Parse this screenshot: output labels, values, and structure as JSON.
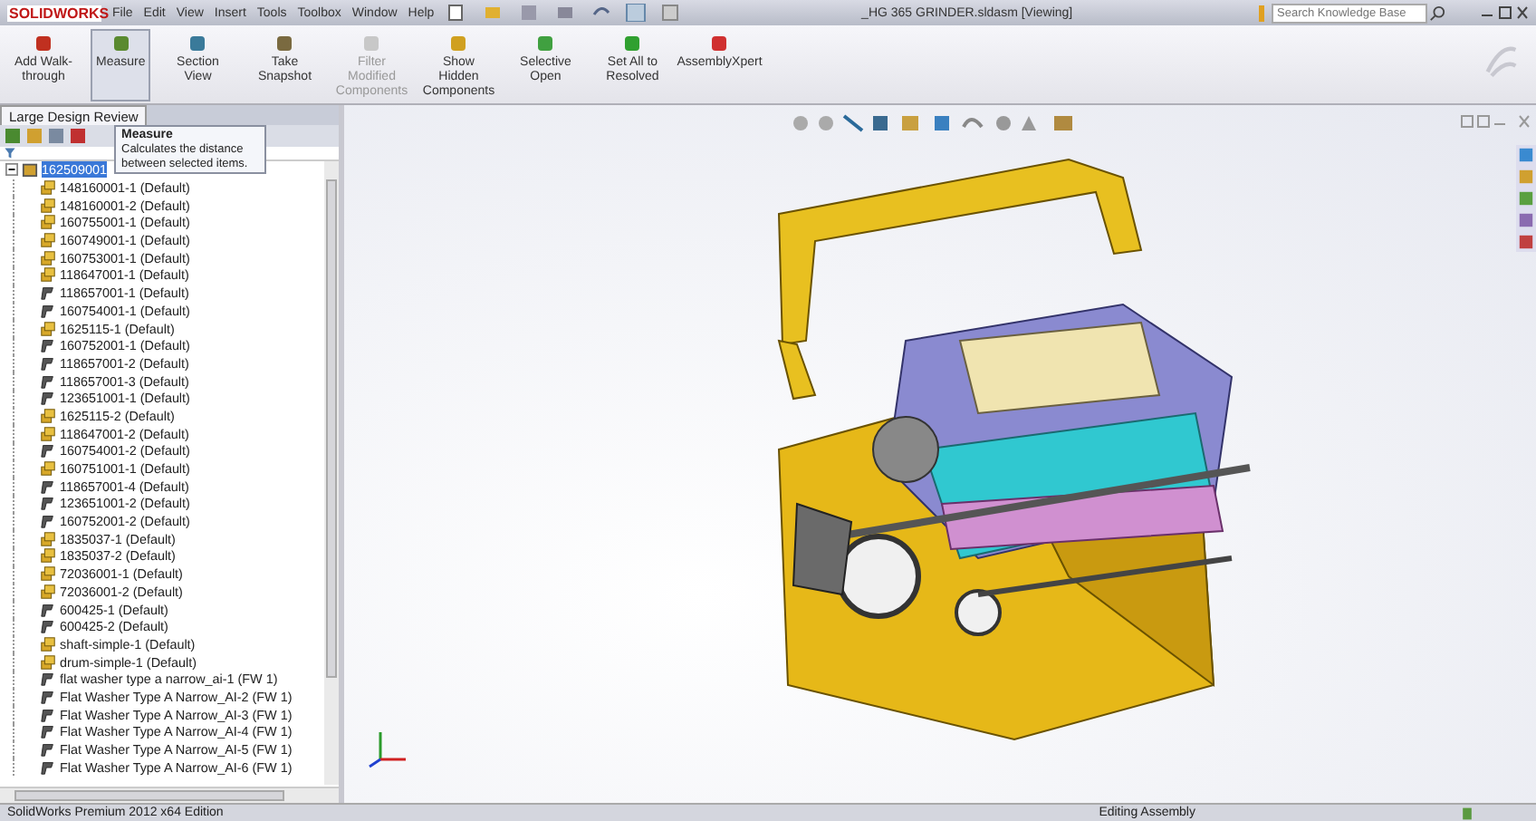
{
  "app": {
    "logo": "SOLIDWORKS",
    "menu": [
      "File",
      "Edit",
      "View",
      "Insert",
      "Tools",
      "Toolbox",
      "Window",
      "Help"
    ],
    "title": "_HG 365 GRINDER.sldasm [Viewing]",
    "search": {
      "placeholder": "Search Knowledge Base"
    }
  },
  "ribbon": [
    {
      "label": "Add Walk-through",
      "selected": false,
      "disabled": false
    },
    {
      "label": "Measure",
      "selected": true,
      "disabled": false
    },
    {
      "label": "Section View",
      "selected": false,
      "disabled": false
    },
    {
      "label": "Take Snapshot",
      "selected": false,
      "disabled": false
    },
    {
      "label": "Filter Modified Components",
      "selected": false,
      "disabled": true
    },
    {
      "label": "Show Hidden Components",
      "selected": false,
      "disabled": false
    },
    {
      "label": "Selective Open",
      "selected": false,
      "disabled": false
    },
    {
      "label": "Set All to Resolved",
      "selected": false,
      "disabled": false
    },
    {
      "label": "AssemblyXpert",
      "selected": false,
      "disabled": false
    }
  ],
  "panel": {
    "tab": "Large Design Review",
    "tooltip": {
      "title": "Measure",
      "text": "Calculates the distance between selected items."
    },
    "tree": {
      "label": "162509001",
      "selected": true,
      "expanded": true,
      "children": [
        {
          "label": "148160001-1 (Default)",
          "kind": "assembly"
        },
        {
          "label": "148160001-2 (Default)",
          "kind": "assembly"
        },
        {
          "label": "160755001-1 (Default)",
          "kind": "assembly"
        },
        {
          "label": "160749001-1 (Default)",
          "kind": "assembly"
        },
        {
          "label": "160753001-1 (Default)",
          "kind": "assembly"
        },
        {
          "label": "118647001-1 (Default)",
          "kind": "assembly"
        },
        {
          "label": "118657001-1 (Default)",
          "kind": "part"
        },
        {
          "label": "160754001-1 (Default)",
          "kind": "part"
        },
        {
          "label": "1625115-1 (Default)",
          "kind": "assembly"
        },
        {
          "label": "160752001-1 (Default)",
          "kind": "part"
        },
        {
          "label": "118657001-2 (Default)",
          "kind": "part"
        },
        {
          "label": "118657001-3 (Default)",
          "kind": "part"
        },
        {
          "label": "123651001-1 (Default)",
          "kind": "part"
        },
        {
          "label": "1625115-2 (Default)",
          "kind": "assembly"
        },
        {
          "label": "118647001-2 (Default)",
          "kind": "assembly"
        },
        {
          "label": "160754001-2 (Default)",
          "kind": "part"
        },
        {
          "label": "160751001-1 (Default)",
          "kind": "assembly"
        },
        {
          "label": "118657001-4 (Default)",
          "kind": "part"
        },
        {
          "label": "123651001-2 (Default)",
          "kind": "part"
        },
        {
          "label": "160752001-2 (Default)",
          "kind": "part"
        },
        {
          "label": "1835037-1 (Default)",
          "kind": "assembly"
        },
        {
          "label": "1835037-2 (Default)",
          "kind": "assembly"
        },
        {
          "label": "72036001-1 (Default)",
          "kind": "assembly"
        },
        {
          "label": "72036001-2 (Default)",
          "kind": "assembly"
        },
        {
          "label": "600425-1 (Default)",
          "kind": "part"
        },
        {
          "label": "600425-2 (Default)",
          "kind": "part"
        },
        {
          "label": "shaft-simple-1 (Default)",
          "kind": "assembly"
        },
        {
          "label": "drum-simple-1 (Default)",
          "kind": "assembly"
        },
        {
          "label": "flat washer type a narrow_ai-1 (FW 1)",
          "kind": "part"
        },
        {
          "label": "Flat Washer Type A Narrow_AI-2 (FW 1)",
          "kind": "part"
        },
        {
          "label": "Flat Washer Type A Narrow_AI-3 (FW 1)",
          "kind": "part"
        },
        {
          "label": "Flat Washer Type A Narrow_AI-4 (FW 1)",
          "kind": "part"
        },
        {
          "label": "Flat Washer Type A Narrow_AI-5 (FW 1)",
          "kind": "part"
        },
        {
          "label": "Flat Washer Type A Narrow_AI-6 (FW 1)",
          "kind": "part"
        }
      ]
    }
  },
  "status_bar": {
    "edition": "SolidWorks Premium 2012 x64 Edition",
    "mode": "Editing Assembly"
  }
}
